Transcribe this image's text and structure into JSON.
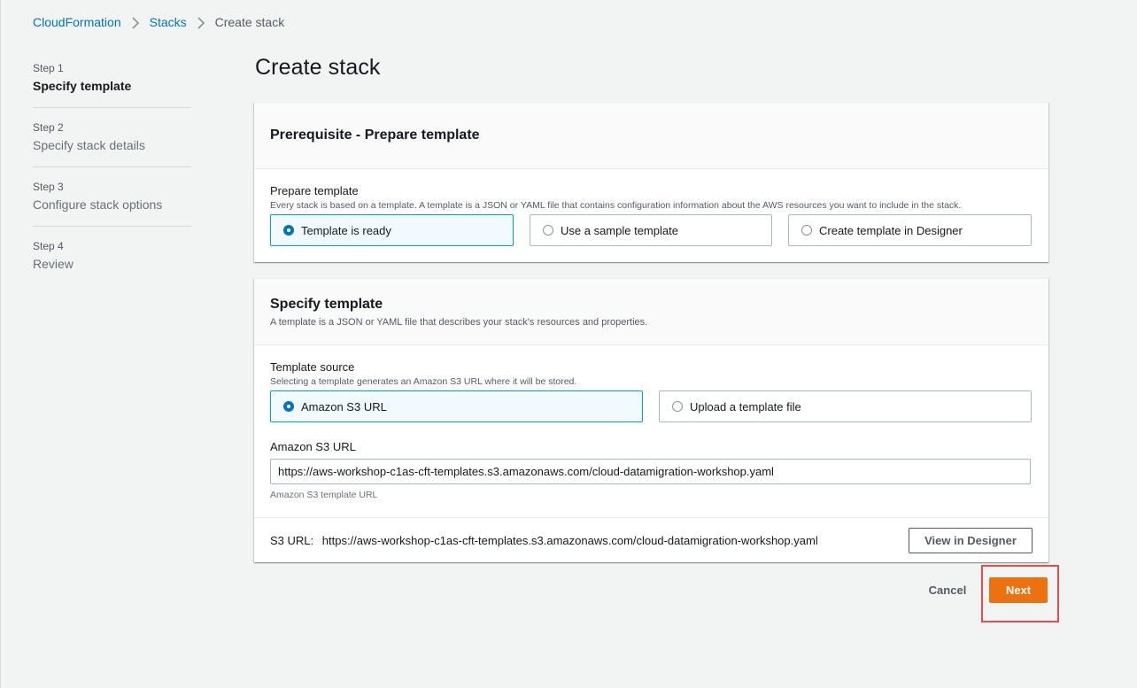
{
  "breadcrumb": {
    "items": [
      "CloudFormation",
      "Stacks"
    ],
    "current": "Create stack"
  },
  "steps": [
    {
      "num": "Step 1",
      "title": "Specify template"
    },
    {
      "num": "Step 2",
      "title": "Specify stack details"
    },
    {
      "num": "Step 3",
      "title": "Configure stack options"
    },
    {
      "num": "Step 4",
      "title": "Review"
    }
  ],
  "page_title": "Create stack",
  "prerequisite": {
    "header": "Prerequisite - Prepare template",
    "field_label": "Prepare template",
    "field_desc": "Every stack is based on a template. A template is a JSON or YAML file that contains configuration information about the AWS resources you want to include in the stack.",
    "options": [
      "Template is ready",
      "Use a sample template",
      "Create template in Designer"
    ],
    "selected": "Template is ready"
  },
  "specify": {
    "header": "Specify template",
    "header_desc": "A template is a JSON or YAML file that describes your stack's resources and properties.",
    "source_label": "Template source",
    "source_desc": "Selecting a template generates an Amazon S3 URL where it will be stored.",
    "options": [
      "Amazon S3 URL",
      "Upload a template file"
    ],
    "selected": "Amazon S3 URL",
    "url_label": "Amazon S3 URL",
    "url_value": "https://aws-workshop-c1as-cft-templates.s3.amazonaws.com/cloud-datamigration-workshop.yaml",
    "url_constraint": "Amazon S3 template URL",
    "s3_url_label": "S3 URL:",
    "s3_url_value": "https://aws-workshop-c1as-cft-templates.s3.amazonaws.com/cloud-datamigration-workshop.yaml",
    "view_designer_label": "View in Designer"
  },
  "actions": {
    "cancel_label": "Cancel",
    "next_label": "Next"
  },
  "colors": {
    "accent": "#0073bb",
    "primary_button": "#ec7211",
    "highlight_box": "#ed4a4a"
  }
}
